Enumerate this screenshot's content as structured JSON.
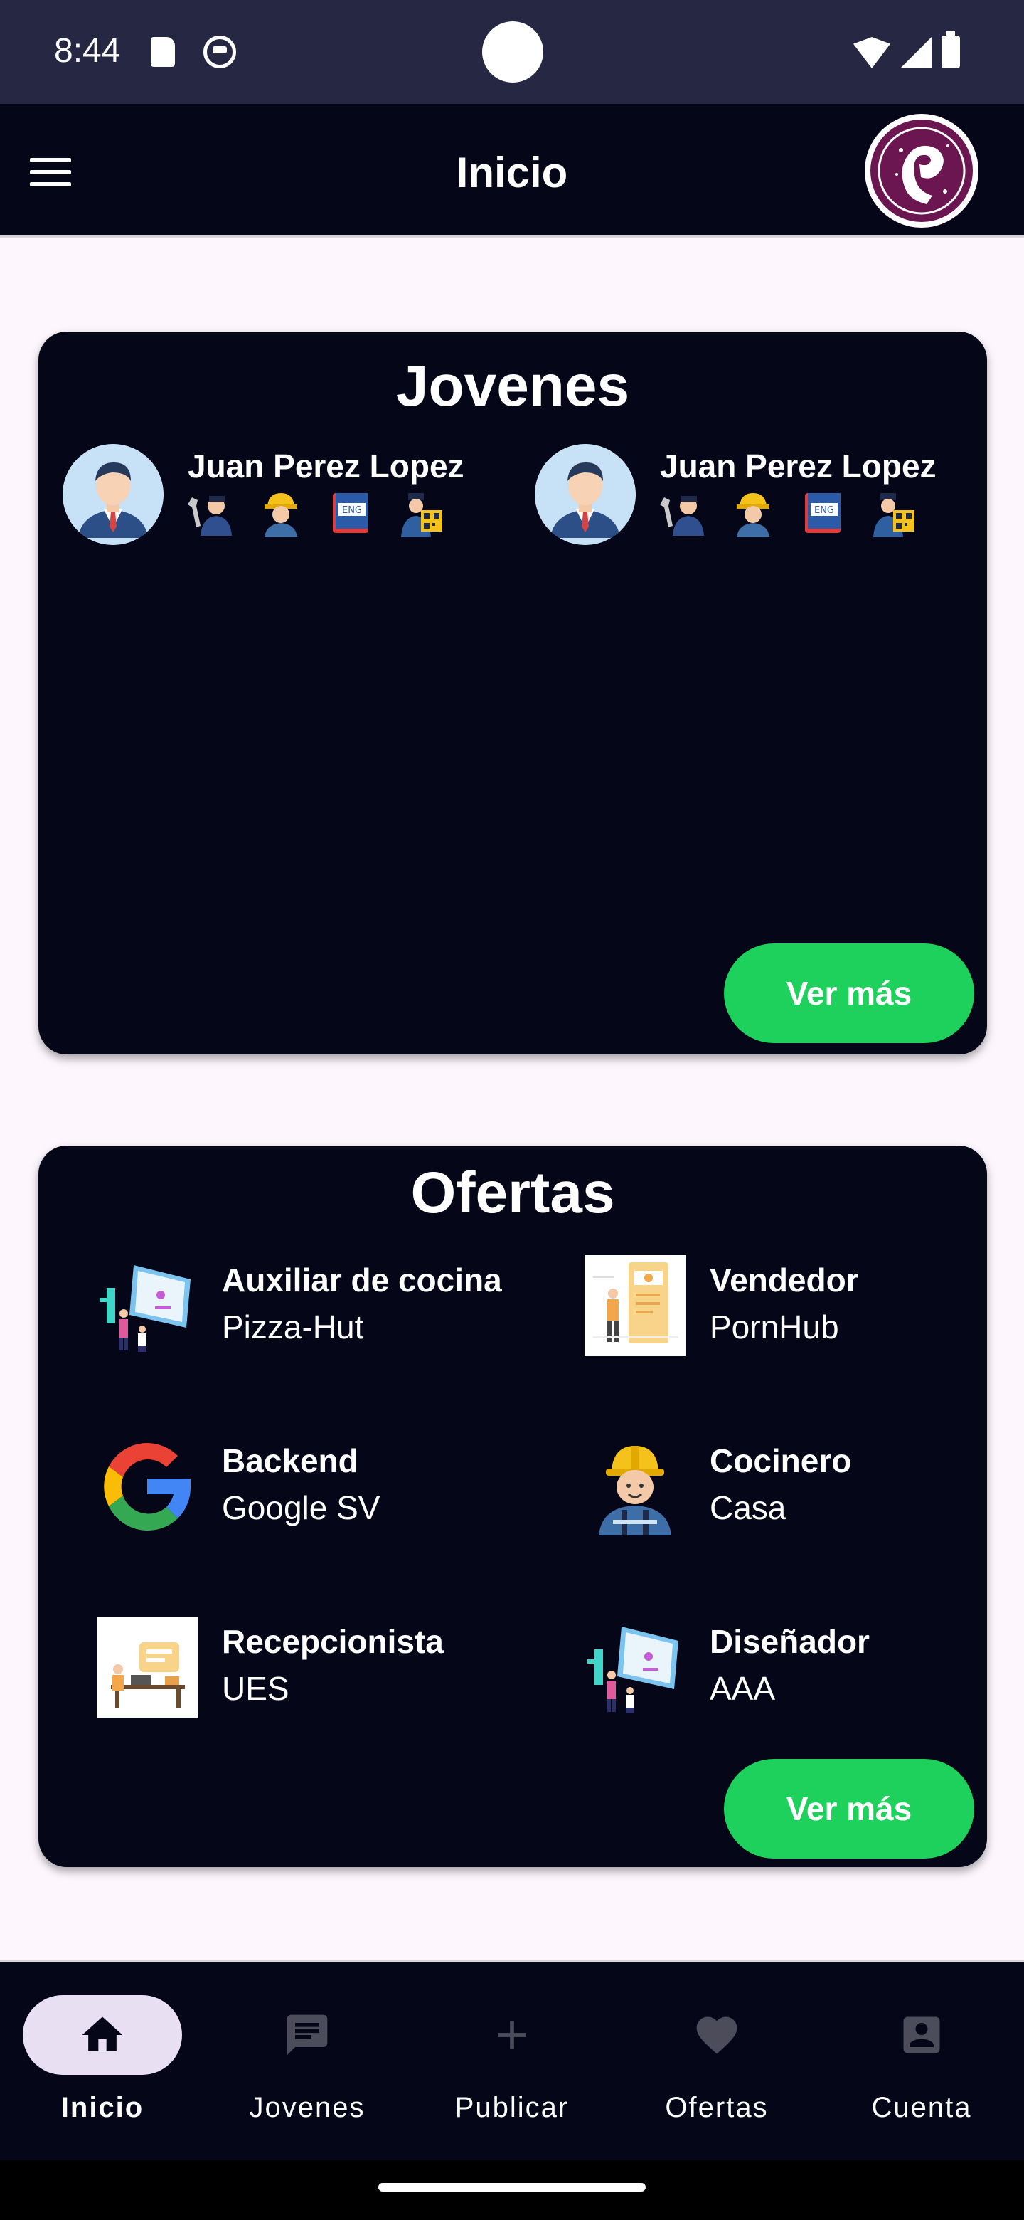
{
  "status_bar": {
    "time": "8:44"
  },
  "app_bar": {
    "title": "Inicio"
  },
  "jovenes_card": {
    "title": "Jovenes",
    "people": [
      {
        "name": "Juan Perez Lopez",
        "badges": [
          "mechanic-icon",
          "worker-icon",
          "english-book-icon",
          "qr-worker-icon"
        ]
      },
      {
        "name": "Juan Perez Lopez",
        "badges": [
          "mechanic-icon",
          "worker-icon",
          "english-book-icon",
          "qr-worker-icon"
        ]
      }
    ],
    "more_label": "Ver más"
  },
  "ofertas_card": {
    "title": "Ofertas",
    "offers": [
      {
        "title": "Auxiliar de cocina",
        "company": "Pizza-Hut",
        "icon": "presentation-screen-icon"
      },
      {
        "title": "Vendedor",
        "company": "PornHub",
        "icon": "meeting-board-icon"
      },
      {
        "title": "Backend",
        "company": "Google SV",
        "icon": "google-logo-icon"
      },
      {
        "title": "Cocinero",
        "company": "Casa",
        "icon": "construction-worker-icon"
      },
      {
        "title": "Recepcionista",
        "company": "UES",
        "icon": "office-desk-icon"
      },
      {
        "title": "Diseñador",
        "company": "AAA",
        "icon": "presentation-screen-icon"
      }
    ],
    "more_label": "Ver más"
  },
  "bottom_nav": {
    "items": [
      {
        "label": "Inicio",
        "icon": "home-icon",
        "active": true
      },
      {
        "label": "Jovenes",
        "icon": "chat-icon",
        "active": false
      },
      {
        "label": "Publicar",
        "icon": "plus-icon",
        "active": false
      },
      {
        "label": "Ofertas",
        "icon": "heart-icon",
        "active": false
      },
      {
        "label": "Cuenta",
        "icon": "account-icon",
        "active": false
      }
    ]
  },
  "colors": {
    "card_bg": "#050617",
    "accent_green": "#1ed05c",
    "page_bg": "#fdf7fd",
    "status_bar": "#262843",
    "nav_active_pill": "#e9dff3"
  }
}
